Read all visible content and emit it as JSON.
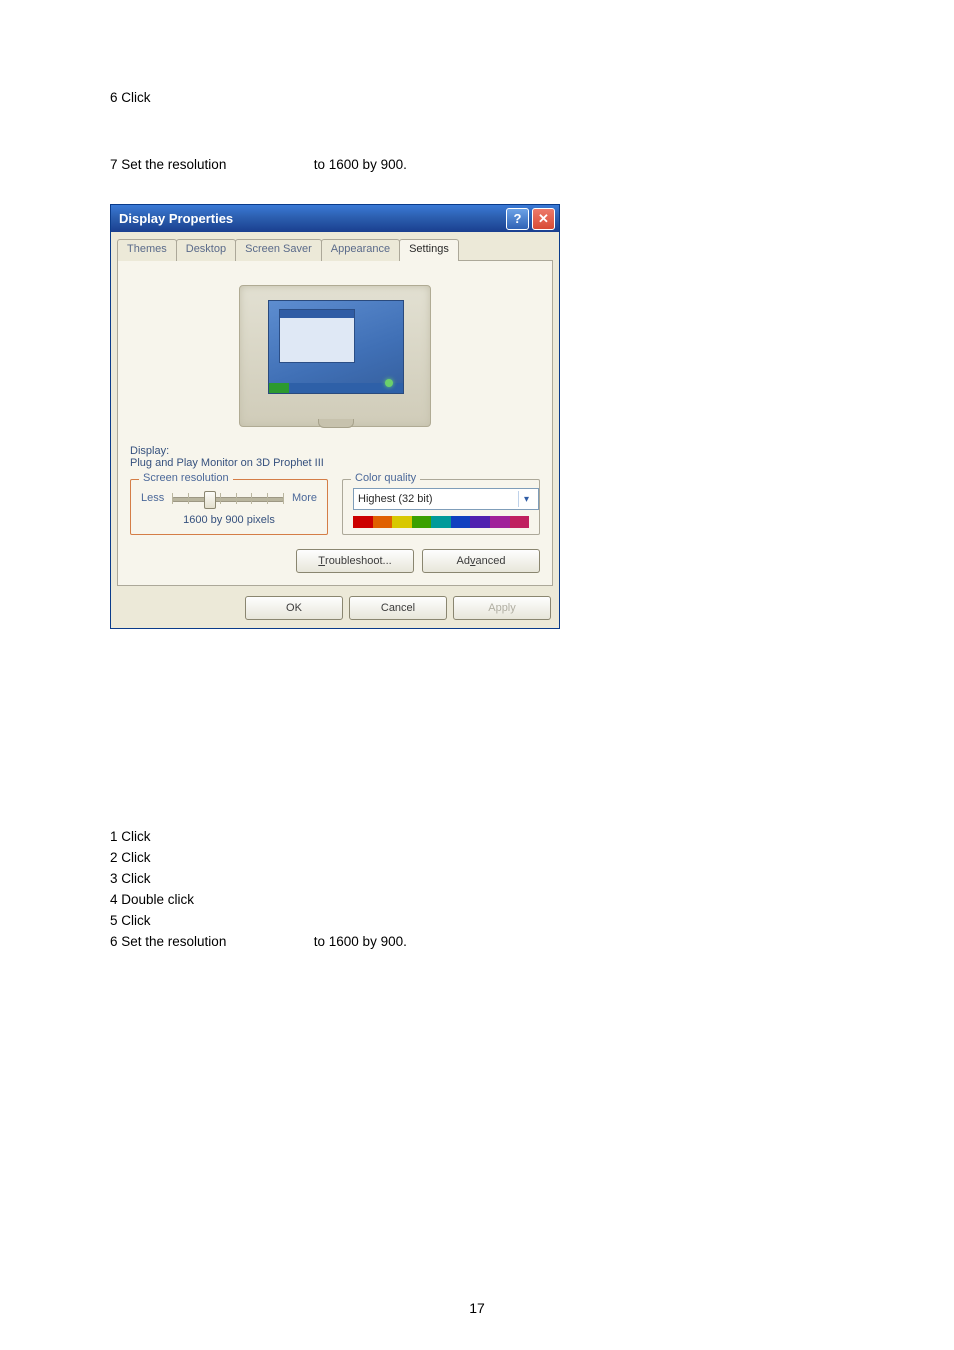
{
  "top_steps": {
    "s6": "6 Click",
    "s7_a": "7 Set the resolution",
    "s7_b": "to 1600 by 900."
  },
  "dialog": {
    "title": "Display Properties",
    "tabs": [
      "Themes",
      "Desktop",
      "Screen Saver",
      "Appearance",
      "Settings"
    ],
    "display_label": "Display:",
    "display_value": "Plug and Play Monitor on 3D Prophet III",
    "resolution": {
      "legend": "Screen resolution",
      "less": "Less",
      "more": "More",
      "value": "1600 by 900 pixels"
    },
    "color_quality": {
      "legend": "Color quality",
      "value": "Highest (32 bit)"
    },
    "buttons": {
      "troubleshoot": "Troubleshoot...",
      "advanced": "Advanced",
      "ok": "OK",
      "cancel": "Cancel",
      "apply": "Apply"
    }
  },
  "bottom_steps": {
    "s1": "1 Click",
    "s2": "2 Click",
    "s3": "3 Click",
    "s4": "4 Double click",
    "s5": "5 Click",
    "s6_a": "6 Set the resolution",
    "s6_b": "to 1600 by 900."
  },
  "page_number": "17"
}
